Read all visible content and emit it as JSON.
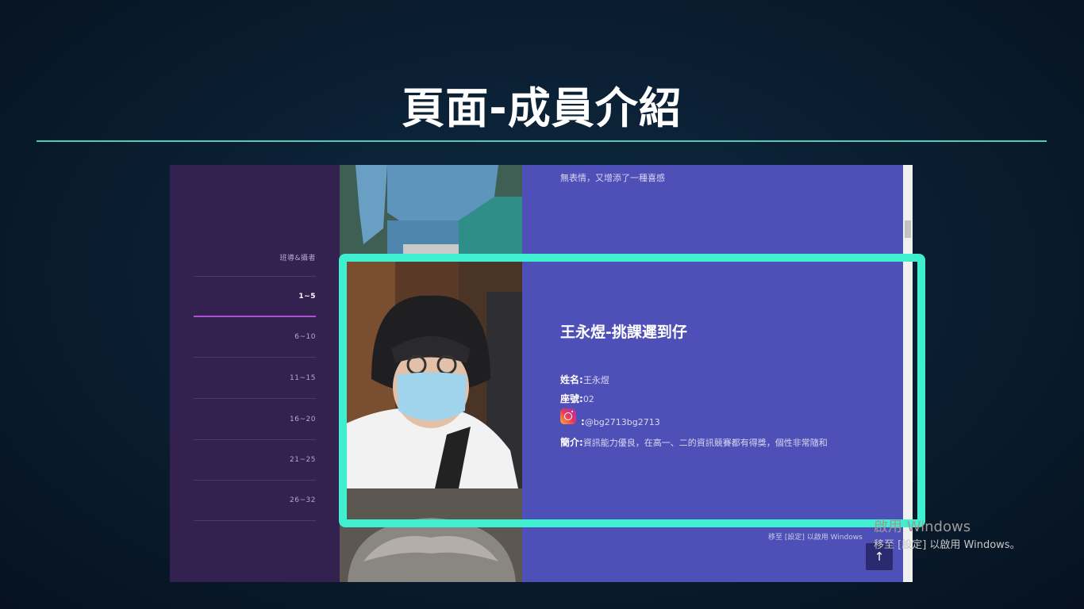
{
  "slide": {
    "title": "頁面-成員介紹"
  },
  "sidebar": {
    "items": [
      {
        "label": "班導&攝者",
        "active": false
      },
      {
        "label": "1~5",
        "active": true
      },
      {
        "label": "6~10",
        "active": false
      },
      {
        "label": "11~15",
        "active": false
      },
      {
        "label": "16~20",
        "active": false
      },
      {
        "label": "21~25",
        "active": false
      },
      {
        "label": "26~32",
        "active": false
      }
    ]
  },
  "content": {
    "prev_text": "無表情，又增添了一種喜感",
    "member_title": "王永煜-挑課遲到仔",
    "name_label": "姓名:",
    "name_value": "王永煜",
    "seat_label": "座號:",
    "seat_value": "02",
    "ig_prefix": ":",
    "ig_handle": "@bg2713bg2713",
    "intro_label": "簡介:",
    "intro_value": "資訊能力優良，在高一、二的資訊競賽都有得獎，個性非常隨和"
  },
  "back_to_top": {
    "icon": "arrow-up-icon",
    "symbol": "↑"
  },
  "watermark": {
    "inner": "移至 [設定] 以啟用 Windows",
    "title": "啟用 Windows",
    "subtitle": "移至 [設定] 以啟用 Windows。"
  },
  "colors": {
    "accent_frame": "#3ef0cf",
    "title_rule": "#4ecdb4",
    "sidebar_bg": "#33214f",
    "content_bg": "#4f4fb8"
  }
}
